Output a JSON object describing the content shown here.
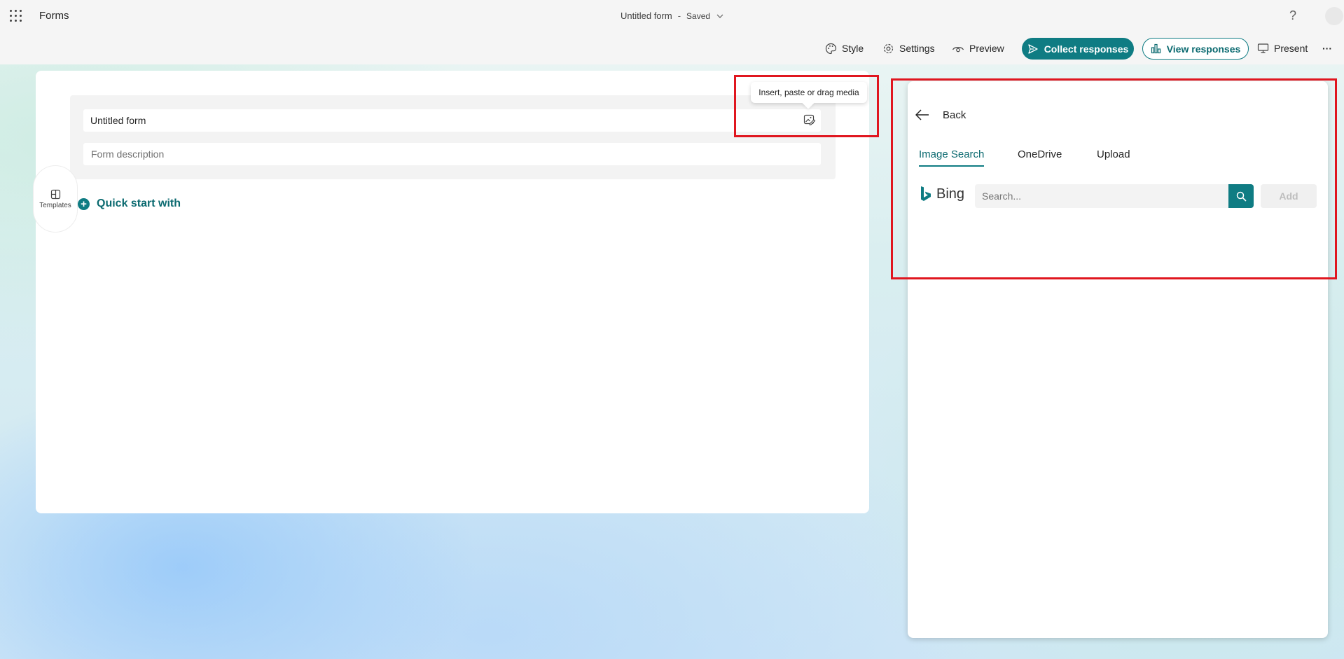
{
  "header": {
    "app_name": "Forms",
    "doc_title": "Untitled form",
    "separator": "-",
    "save_status": "Saved",
    "help": "?"
  },
  "toolbar": {
    "style_label": "Style",
    "settings_label": "Settings",
    "preview_label": "Preview",
    "collect_label": "Collect responses",
    "view_label": "View responses",
    "present_label": "Present",
    "more": "···"
  },
  "form": {
    "title": "Untitled form",
    "description_placeholder": "Form description",
    "media_tooltip": "Insert, paste or drag media",
    "templates_label": "Templates",
    "quick_start_label": "Quick start with",
    "quick_start_icon": "+"
  },
  "panel": {
    "back_label": "Back",
    "tabs": [
      {
        "label": "Image Search",
        "active": true
      },
      {
        "label": "OneDrive",
        "active": false
      },
      {
        "label": "Upload",
        "active": false
      }
    ],
    "bing_label": "Bing",
    "search_placeholder": "Search...",
    "add_label": "Add"
  },
  "colors": {
    "accent": "#0f7c83",
    "highlight": "#e0161f"
  }
}
